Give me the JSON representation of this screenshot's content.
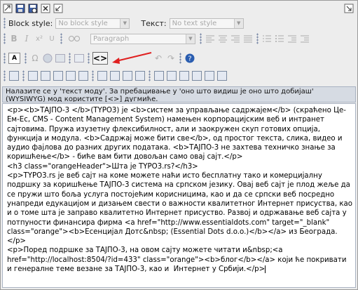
{
  "toolbar": {
    "block_style_label": "Block style:",
    "block_style_placeholder": "No block style",
    "text_style_label": "Текст:",
    "text_style_placeholder": "No text style",
    "format_value": "Paragraph",
    "forecolor_label": "A",
    "source_label": "<>",
    "help_label": "?"
  },
  "notice": {
    "text": "Налазите се у 'текст моду'. За пребацивање у 'оно што видиш је оно што добијаш' (WYSIWYG) мод користите [<>] дугмиће."
  },
  "editor": {
    "content": "<p><b>ТАЈПО-3 </b>(TYPO3) је <b>систем за управљање садржајем</b> (скраћено Це-Ем-Ес, CMS - Content Management System) намењен корпорацијским веб и интранет сајтовима. Пружа изузетну флексибилност, али и заокружен скуп готових опција, функција и модула. <b>Садржај може бити све</b>, од простог текста, слика, видео и аудио фајлова до разних других података. <b>ТАЈПО-3 не захтева техничко знање за коришћење</b> - биће вам бити довољан само овај сајт.</p>\n<h3 class=\"orangeHeader\">Шта је TYPO3.rs?</h3>\n<p>TYPO3.rs је веб сајт на коме можете наћи исто бесплатну тако и комерцијалну подршку за коришћење ТАЈПО-3 система на српском језику. Овај веб сајт је плод жеље да се пружи што боља услуга постојећим корисницима, као и да се српски веб посредно унапреди едукацијом и дизањем свести о важности квалитетног Интернет присуства, као и о томе шта је заправо квалитетно Интернет присуство. Развој и одржавање веб сајта у потпуности финансира фирма <a href=\"http://www.essentialdots.com\" target=\"_blank\" class=\"orange\"><b>Есенцијал Дотс&nbsp; (Essential Dots d.o.o.)</b></a> из Београда.</p>\n<p>Поред подршке за ТАЈПО-3, на овом сајту можете читати и&nbsp;<a href=\"http://localhost:8504/?id=433\" class=\"orange\"><b>блог</b></a> који ће покривати и генералне теме везане за ТАЈПО-3, као и  Интернет у Србији.</p>"
  },
  "colors": {
    "background": "#ededed",
    "notice_bg": "#d6dbe3",
    "arrow": "#e02020",
    "help_blue": "#2a5db0"
  },
  "icons": [
    "toggle-mode-icon",
    "save-icon",
    "save-view-icon",
    "close-icon",
    "undo-icon",
    "more-icon",
    "bold-icon",
    "italic-icon",
    "superscript-icon",
    "subscript-icon",
    "align-left-icon",
    "align-center-icon",
    "align-right-icon",
    "justify-icon",
    "ordered-list-icon",
    "unordered-list-icon",
    "outdent-icon",
    "indent-icon",
    "special-char-icon",
    "link-icon",
    "image-icon",
    "find-icon",
    "source-toggle-icon",
    "undo-edit-icon",
    "redo-edit-icon",
    "help-icon",
    "table-icon",
    "arrow-annotation"
  ]
}
